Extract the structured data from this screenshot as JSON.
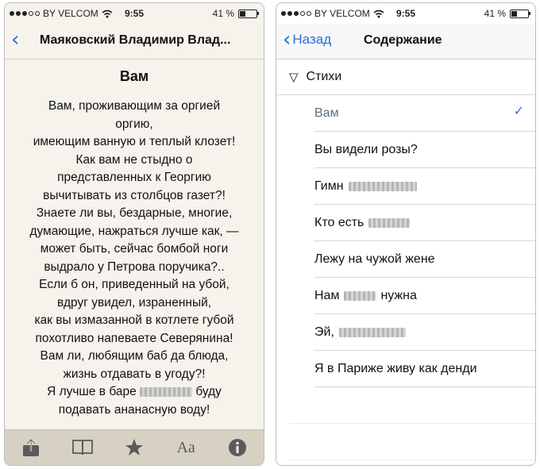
{
  "status": {
    "carrier": "BY VELCOM",
    "time": "9:55",
    "battery_text": "41 %",
    "battery_level": 0.41
  },
  "reader": {
    "title": "Маяковский Владимир Влад...",
    "poem_title": "Вам",
    "lines": [
      "Вам, проживающим за оргией",
      "оргию,",
      "имеющим ванную и теплый клозет!",
      "Как вам не стыдно о",
      "представленных к Георгию",
      "вычитывать из столбцов газет?!",
      "Знаете ли вы, бездарные, многие,",
      "думающие, нажраться лучше как, —",
      "может быть, сейчас бомбой ноги",
      "выдрало у Петрова поручика?..",
      "Если б он, приведенный на убой,",
      "вдруг увидел, израненный,",
      "как вы измазанной в котлете губой",
      "похотливо напеваете Северянина!",
      "Вам ли, любящим баб да блюда,",
      "жизнь отдавать в угоду?!"
    ],
    "line_17a": "Я лучше в баре",
    "line_17b": "буду",
    "line_18": "подавать ананасную воду!"
  },
  "toolbar": {
    "icons": [
      "share-icon",
      "book-icon",
      "star-icon",
      "font-icon",
      "info-icon"
    ],
    "font_label": "Aa"
  },
  "toc": {
    "back_label": "Назад",
    "title": "Содержание",
    "section": "Стихи",
    "items": [
      {
        "label": "Вам",
        "active": true
      },
      {
        "label": "Вы видели розы?"
      },
      {
        "label": "Гимн"
      },
      {
        "label": "Кто есть"
      },
      {
        "label": "Лежу на чужой жене"
      },
      {
        "label": "Нам",
        "label_after": "нужна"
      },
      {
        "label": "Эй,"
      },
      {
        "label": "Я в Париже живу как денди"
      }
    ]
  },
  "colors": {
    "accent": "#2c6fd6",
    "paper": "#f6f3ec",
    "toolbar": "#d6d1c3"
  }
}
